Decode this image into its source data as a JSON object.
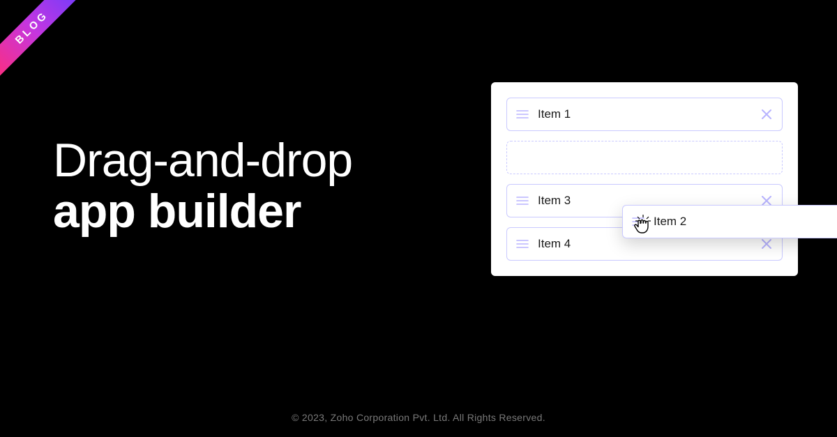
{
  "ribbon": {
    "label": "BLOG"
  },
  "hero": {
    "line1": "Drag-and-drop",
    "line2": "app builder"
  },
  "panel": {
    "items": [
      {
        "label": "Item 1",
        "state": "placed"
      },
      {
        "label": "Item 2",
        "state": "dragging"
      },
      {
        "label": "Item 3",
        "state": "placed"
      },
      {
        "label": "Item 4",
        "state": "placed"
      }
    ]
  },
  "floating_item": {
    "label": "Item 2"
  },
  "footer": {
    "copyright": "© 2023, Zoho Corporation Pvt. Ltd. All Rights Reserved."
  },
  "colors": {
    "item_border": "#c9c9ff",
    "icon": "#b8b4ff",
    "ribbon_gradient": [
      "#ff2d7a",
      "#c536e0",
      "#6a3cff"
    ]
  }
}
